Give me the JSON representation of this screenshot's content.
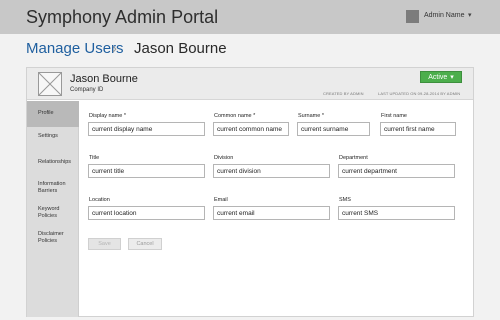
{
  "app": {
    "title": "Symphony Admin Portal",
    "admin_name": "Admin Name",
    "admin_caret": "▾"
  },
  "breadcrumb": {
    "parent": "Manage Users",
    "separator": "›",
    "current": "Jason Bourne"
  },
  "user": {
    "name": "Jason Bourne",
    "company_id": "Company ID",
    "created_by": "CREATED BY ADMIN",
    "last_updated": "LAST UPDATED ON 09-28-2014 BY ADMIN",
    "status": "Active",
    "status_caret": "▾"
  },
  "sidebar": {
    "items": [
      "Profile",
      "Settings",
      "Relationships",
      "Information Barriers",
      "Keyword Policies",
      "Disclaimer Policies"
    ]
  },
  "form": {
    "display_name": {
      "label": "Display name *",
      "value": "current display name"
    },
    "common_name": {
      "label": "Common name *",
      "value": "current common name"
    },
    "surname": {
      "label": "Surname *",
      "value": "current surname"
    },
    "first_name": {
      "label": "First name",
      "value": "current first name"
    },
    "title": {
      "label": "Title",
      "value": "current title"
    },
    "division": {
      "label": "Division",
      "value": "current division"
    },
    "department": {
      "label": "Department",
      "value": "current department"
    },
    "location": {
      "label": "Location",
      "value": "current location"
    },
    "email": {
      "label": "Email",
      "value": "current email"
    },
    "sms": {
      "label": "SMS",
      "value": "current SMS"
    }
  },
  "actions": {
    "save": "Save",
    "cancel": "Cancel"
  },
  "colors": {
    "accent": "#1f5f9f",
    "status_green": "#4cae4c",
    "topbar": "#c8c8c8"
  }
}
